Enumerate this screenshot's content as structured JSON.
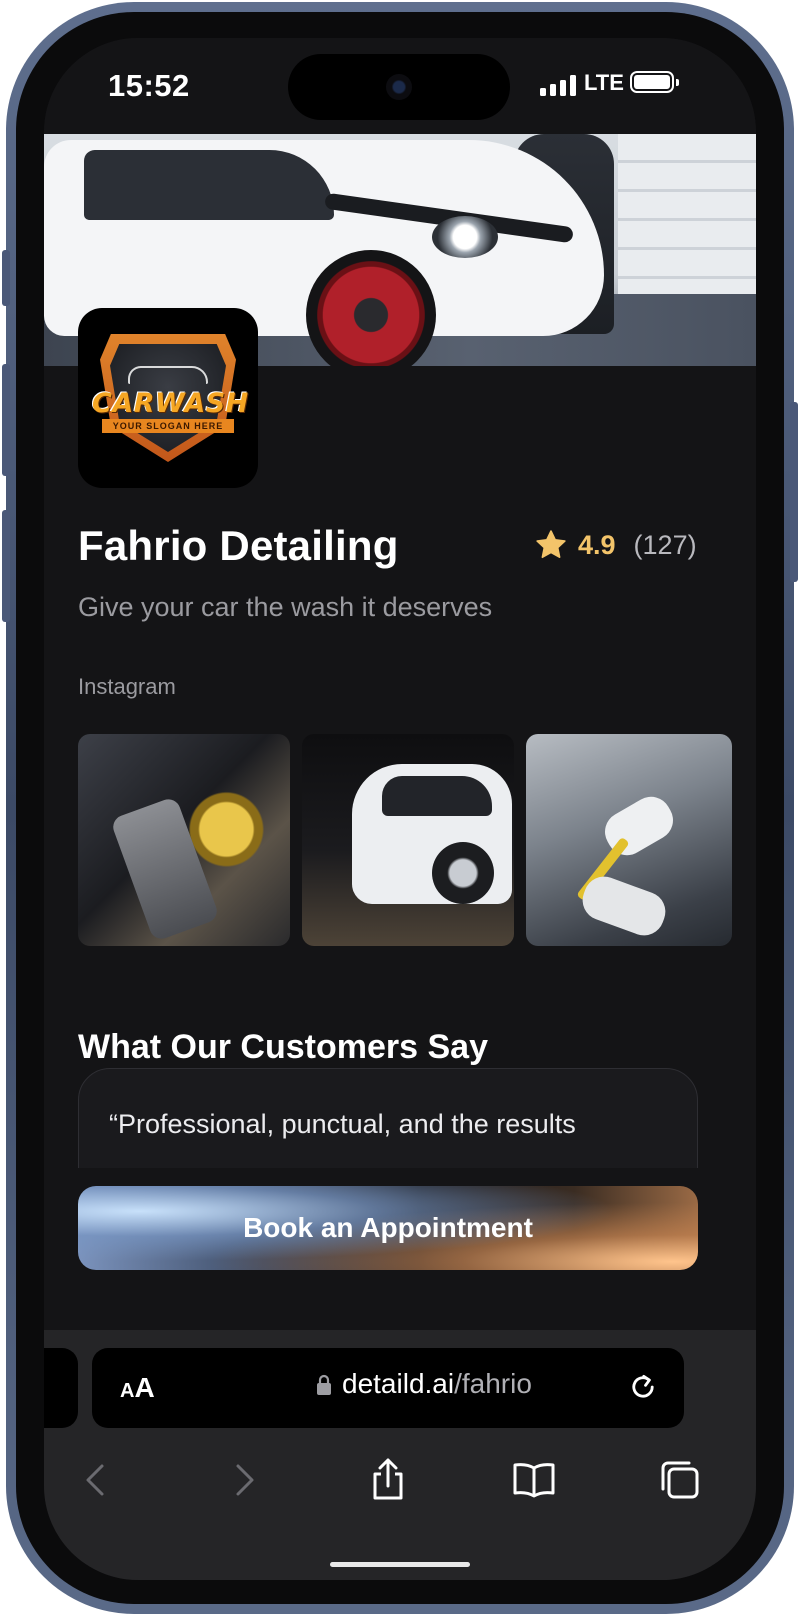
{
  "status_bar": {
    "time": "15:52",
    "network": "LTE"
  },
  "business": {
    "name": "Fahrio Detailing",
    "rating": "4.9",
    "review_count": "(127)",
    "tagline": "Give your car the wash it deserves",
    "logo": {
      "title": "CARWASH",
      "slogan": "YOUR SLOGAN HERE"
    }
  },
  "instagram": {
    "label": "Instagram",
    "photos": [
      "car-polishing-photo",
      "washed-white-car-photo",
      "interior-detailing-photo"
    ]
  },
  "reviews": {
    "title": "What Our Customers Say",
    "items": [
      {
        "text": "“Professional, punctual, and the results"
      }
    ]
  },
  "cta": {
    "label": "Book an Appointment"
  },
  "browser": {
    "aa_small": "A",
    "aa_large": "A",
    "url_host": "detaild.ai",
    "url_path": "/fahrio"
  },
  "colors": {
    "background": "#141416",
    "accent_star": "#f3c46a",
    "text_primary": "#ffffff",
    "text_secondary": "#9b9ba0"
  },
  "icons": [
    "star-icon",
    "lock-icon",
    "reload-icon",
    "back-icon",
    "forward-icon",
    "share-icon",
    "bookmarks-icon",
    "tabs-icon"
  ]
}
